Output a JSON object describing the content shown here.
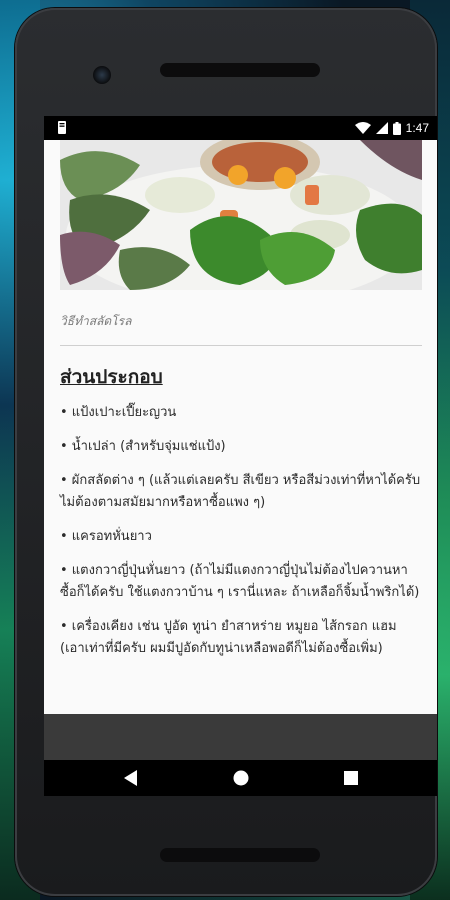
{
  "status_bar": {
    "time": "1:47",
    "icons": [
      "notification-icon",
      "wifi-icon",
      "signal-icon",
      "battery-icon"
    ]
  },
  "hero_image": {
    "description_icon": "food-photo"
  },
  "image_caption": "วิธีทำสลัดโรล",
  "section": {
    "heading": "ส่วนประกอบ",
    "items": [
      "• แป้งเปาะเปี๊ยะญวน",
      "• น้ำเปล่า (สำหรับจุ่มแช่แป้ง)",
      "• ผักสลัดต่าง ๆ (แล้วแต่เลยครับ สีเขียว หรือสีม่วงเท่าที่หาได้ครับ ไม่ต้องตามสมัยมากหรือหาซื้อแพง ๆ)",
      "• แครอทหั่นยาว",
      "• แตงกวาญี่ปุ่นหั่นยาว (ถ้าไม่มีแตงกวาญี่ปุ่นไม่ต้องไปควานหาซื้อก็ได้ครับ ใช้แตงกวาบ้าน ๆ เรานี่แหละ ถ้าเหลือก็จิ้มน้ำพริกได้)",
      "• เครื่องเคียง เช่น ปูอัด ทูน่า ยำสาหร่าย หมูยอ ไส้กรอก แฮม (เอาเท่าที่มีครับ ผมมีปูอัดกับทูน่าเหลือพอดีก็ไม่ต้องซื้อเพิ่ม)"
    ]
  },
  "navigation": {
    "back": "back-icon",
    "home": "home-icon",
    "recents": "recents-icon"
  }
}
